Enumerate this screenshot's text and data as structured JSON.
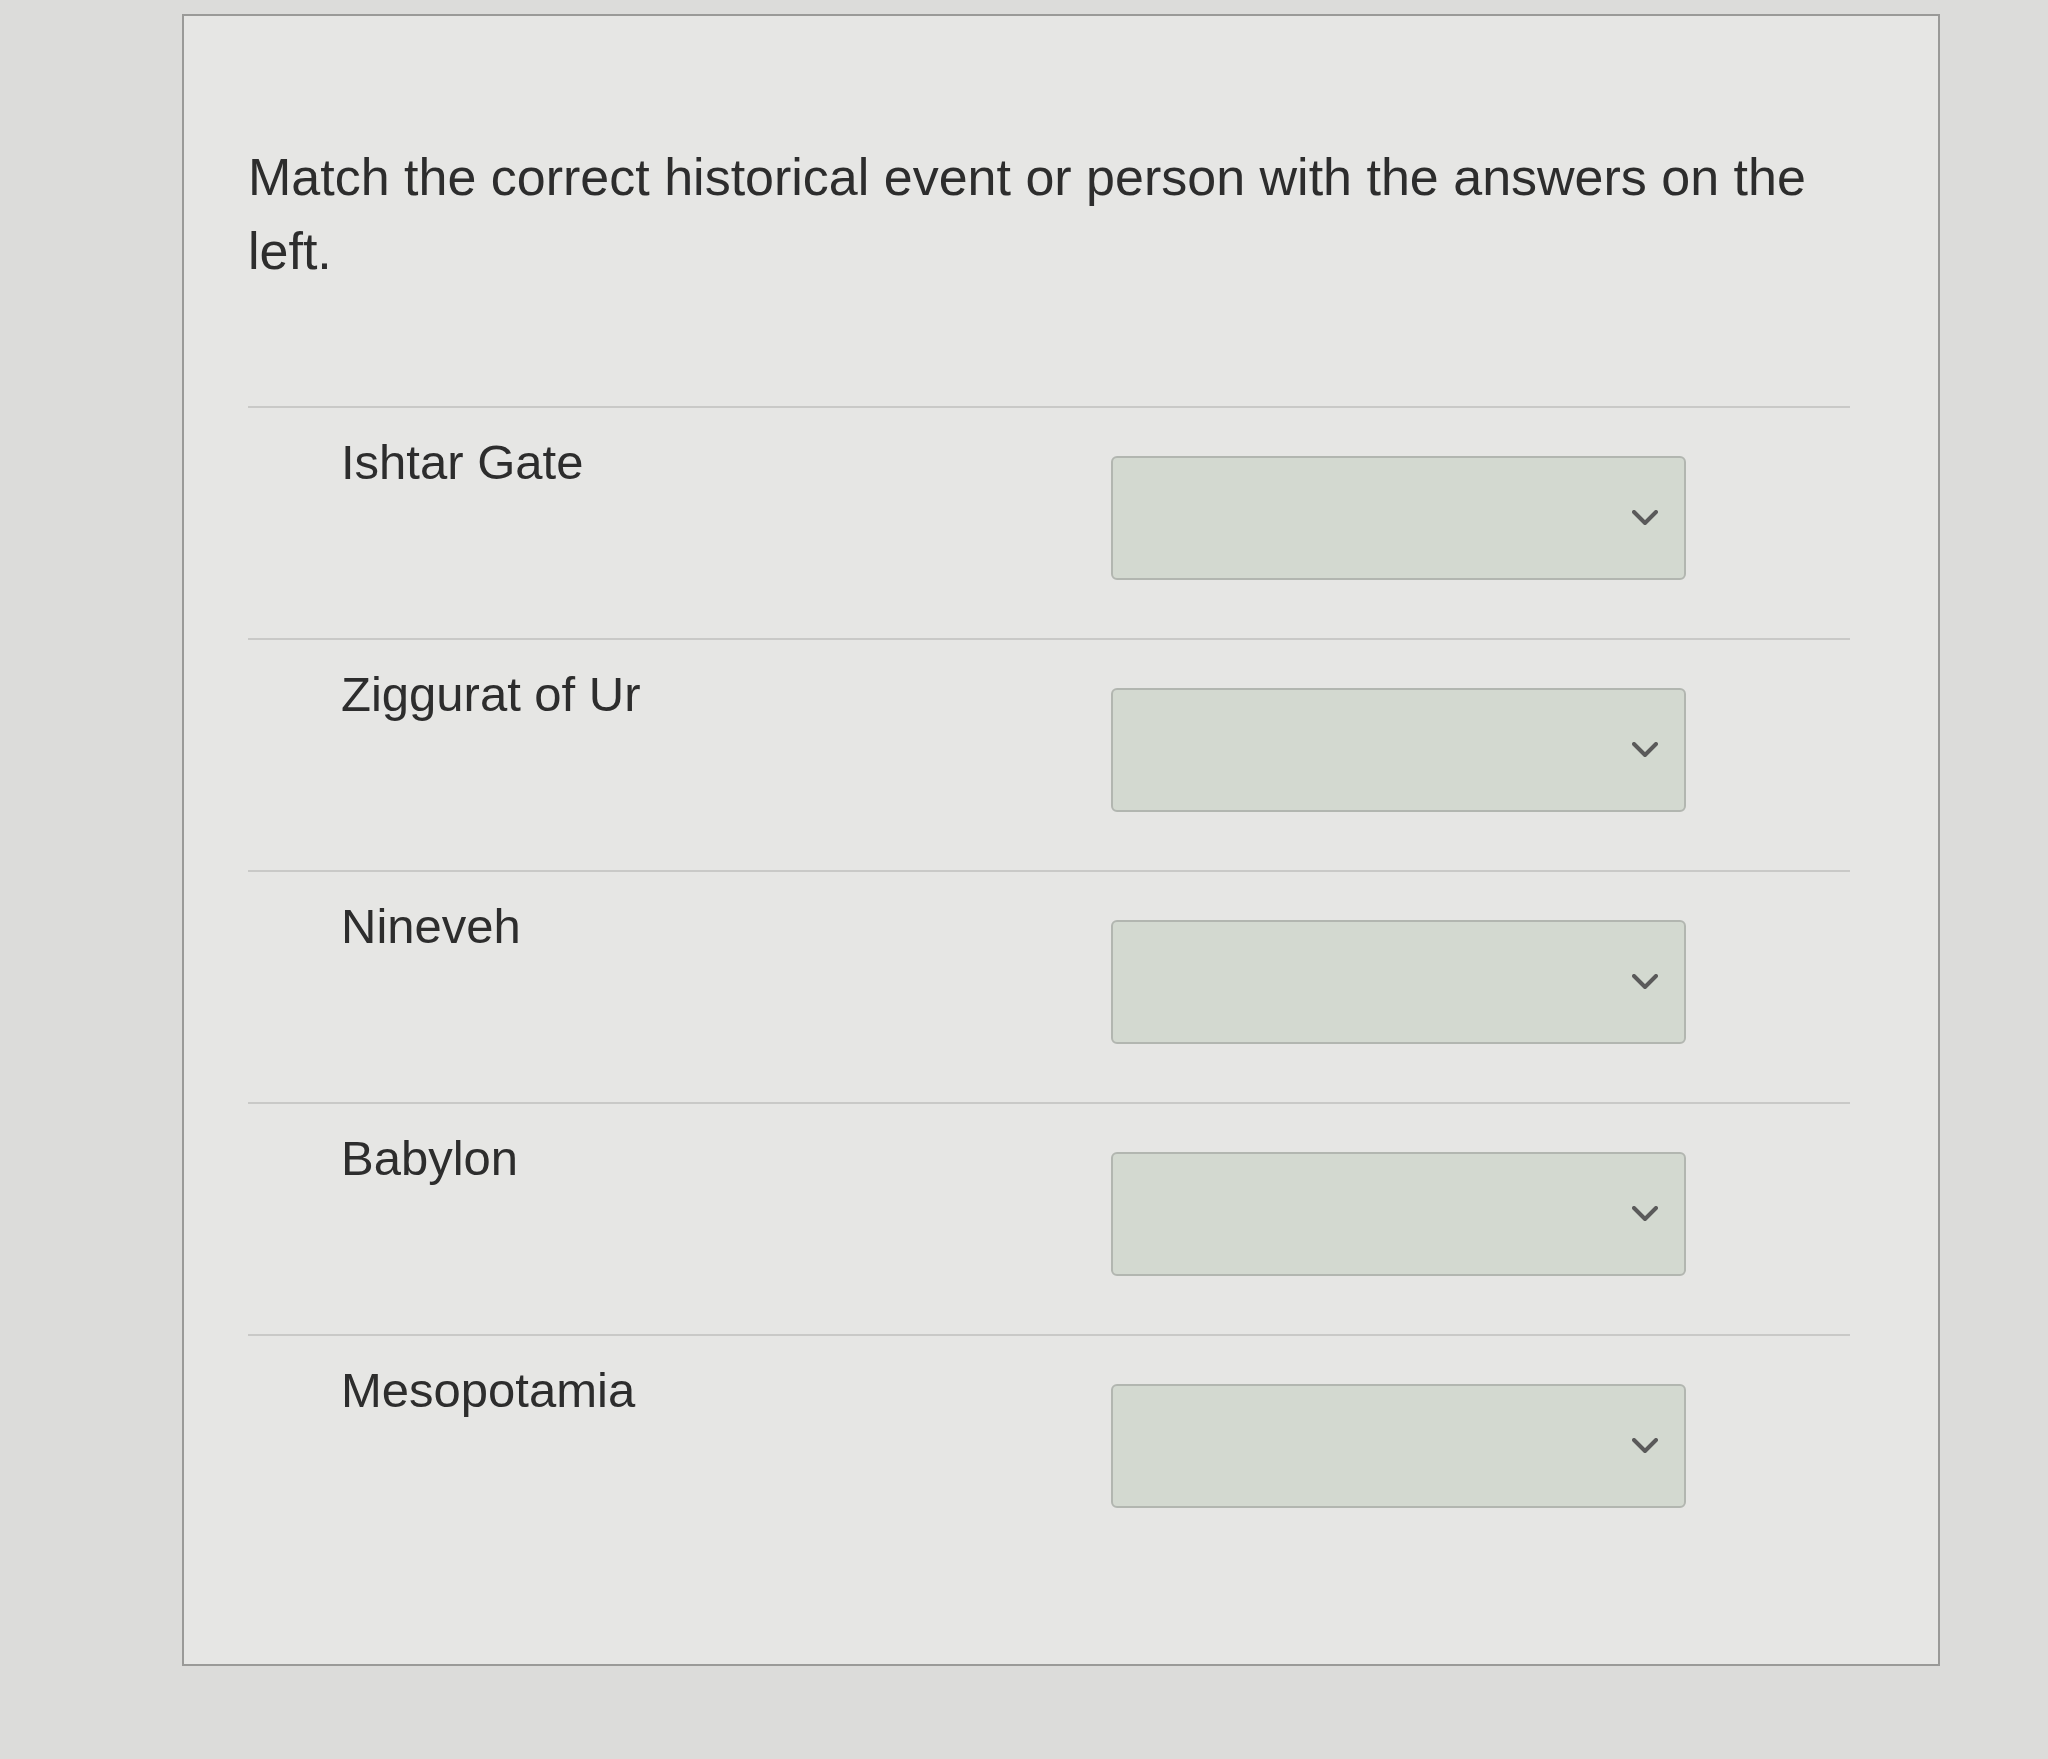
{
  "question": "Match the correct historical event or person with the answers on the left.",
  "items": [
    {
      "label": "Ishtar Gate"
    },
    {
      "label": "Ziggurat of Ur"
    },
    {
      "label": "Nineveh"
    },
    {
      "label": "Babylon"
    },
    {
      "label": "Mesopotamia"
    }
  ]
}
